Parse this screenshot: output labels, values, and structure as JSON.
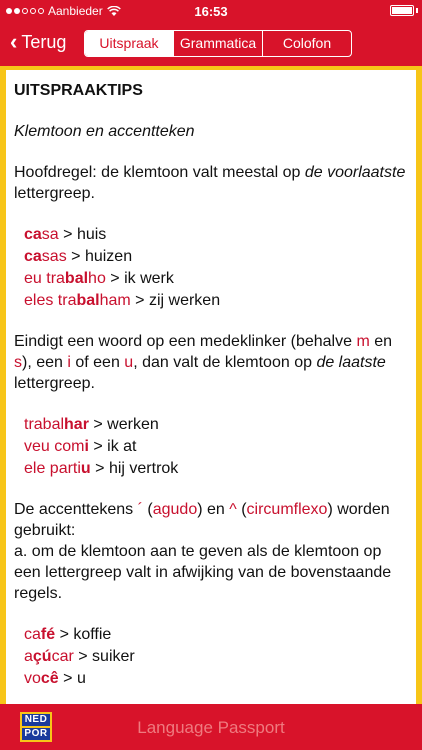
{
  "status": {
    "carrier": "Aanbieder",
    "time": "16:53",
    "battery_level": 1.0
  },
  "nav": {
    "back_label": "Terug",
    "tabs": [
      {
        "label": "Uitspraak",
        "active": true
      },
      {
        "label": "Grammatica",
        "active": false
      },
      {
        "label": "Colofon",
        "active": false
      }
    ]
  },
  "content": {
    "title": "UITSPRAAKTIPS",
    "subtitle": "Klemtoon en accentteken",
    "rule1": {
      "prefix": "Hoofdregel: de klemtoon valt meestal op ",
      "emph": "de voorlaatste",
      "suffix": " lettergreep."
    },
    "examples1": [
      {
        "pre": "",
        "bold": "ca",
        "post": "sa",
        "arrow": " > ",
        "meaning": "huis"
      },
      {
        "pre": "",
        "bold": "ca",
        "post": "sas",
        "arrow": " > ",
        "meaning": "huizen"
      },
      {
        "pre": "eu tra",
        "bold": "bal",
        "post": "ho",
        "arrow": " > ",
        "meaning": "ik werk"
      },
      {
        "pre": "eles tra",
        "bold": "bal",
        "post": "ham",
        "arrow": " > ",
        "meaning": "zij werken"
      }
    ],
    "rule2": {
      "a": "Eindigt een woord op een medeklinker (behalve ",
      "m": "m",
      "b": " en ",
      "s": "s",
      "c": "), een ",
      "i": "i",
      "d": " of een ",
      "u": "u",
      "e": ", dan valt de klemtoon op ",
      "emph": "de laatste",
      "f": " lettergreep."
    },
    "examples2": [
      {
        "pre": "trabal",
        "bold": "har",
        "post": "",
        "arrow": " > ",
        "meaning": "werken"
      },
      {
        "pre": "veu com",
        "bold": "i",
        "post": "",
        "arrow": " > ",
        "meaning": "ik at"
      },
      {
        "pre": "ele parti",
        "bold": "u",
        "post": "",
        "arrow": " > ",
        "meaning": "hij vertrok"
      }
    ],
    "rule3": {
      "a": "De accenttekens ",
      "acute": "´",
      "b": " (",
      "agudo": "agudo",
      "c": ") en ",
      "circ": "^",
      "d": " (",
      "circumflexo": "circumflexo",
      "e": ") worden gebruikt:",
      "line2": "a. om de klemtoon aan te geven als de klemtoon op een lettergreep valt in afwijking van de bovenstaande regels."
    },
    "examples3": [
      {
        "pre": "ca",
        "bold": "fé",
        "post": "",
        "arrow": " > ",
        "meaning": "koffie"
      },
      {
        "pre": "a",
        "bold": "çú",
        "post": "car",
        "arrow": " > ",
        "meaning": "suiker"
      },
      {
        "pre": "vo",
        "bold": "cê",
        "post": "",
        "arrow": " > ",
        "meaning": "u"
      }
    ]
  },
  "footer": {
    "logo_top": "NED",
    "logo_bottom": "POR",
    "title": "Language Passport"
  },
  "colors": {
    "brand_red": "#d8132a",
    "frame_yellow": "#f7c518",
    "accent_red_text": "#c8102e"
  }
}
